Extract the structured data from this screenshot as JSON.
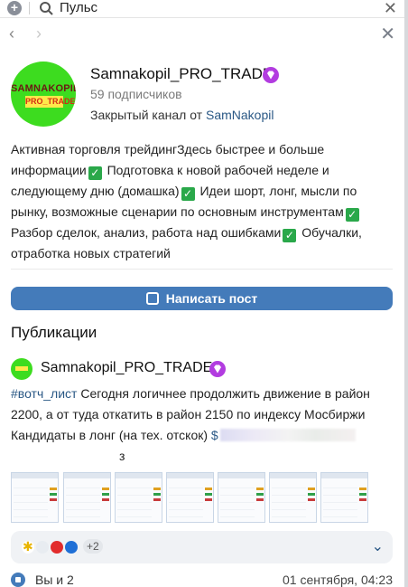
{
  "search": {
    "text": "Пульс"
  },
  "channel": {
    "avatar_line1": "SAMNAKOPIL",
    "avatar_line2": "PRO_TRADE",
    "name": "Samnakopil_PRO_TRADE",
    "subscribers": "59 подписчиков",
    "closed_prefix": "Закрытый канал от ",
    "owner": "SamNakopil"
  },
  "description": {
    "p1": "Активная торговля трейдингЗдесь быстрее и больше информации",
    "p2": " Подготовка к новой рабочей неделе и следующему дню (домашка)",
    "p3": " Идеи шорт, лонг, мысли по рынку, возможные сценарии по основным инструментам",
    "p4": " Разбор сделок, анализ, работа над ошибками",
    "p5": " Обучалки, отработка новых стратегий"
  },
  "write_button": "Написать пост",
  "publications_title": "Публикации",
  "post": {
    "author": "Samnakopil_PRO_TRADE",
    "hashtag": "#вотч_лист",
    "text": " Сегодня логичнее продолжить движение в район 2200, а от туда откатить в район 2150 по индексу Мосбиржи Кандидаты в лонг (на тех. отскок) ",
    "link_start": "$",
    "tail": "з",
    "thumbnails_count": 7,
    "reactions_more": "+2",
    "likes": "Вы и 2",
    "date": "01 сентября, 04:23"
  },
  "colors": {
    "accent": "#447bba",
    "link": "#2a5885",
    "badge": "#b23ce0",
    "avatar_bg": "#3ddc1f"
  },
  "icons": [
    "plus-icon",
    "search-icon",
    "close-icon",
    "back-arrow-icon",
    "forward-arrow-icon",
    "diamond-badge-icon",
    "check-icon",
    "pen-icon",
    "chevron-down-icon",
    "like-icon"
  ]
}
